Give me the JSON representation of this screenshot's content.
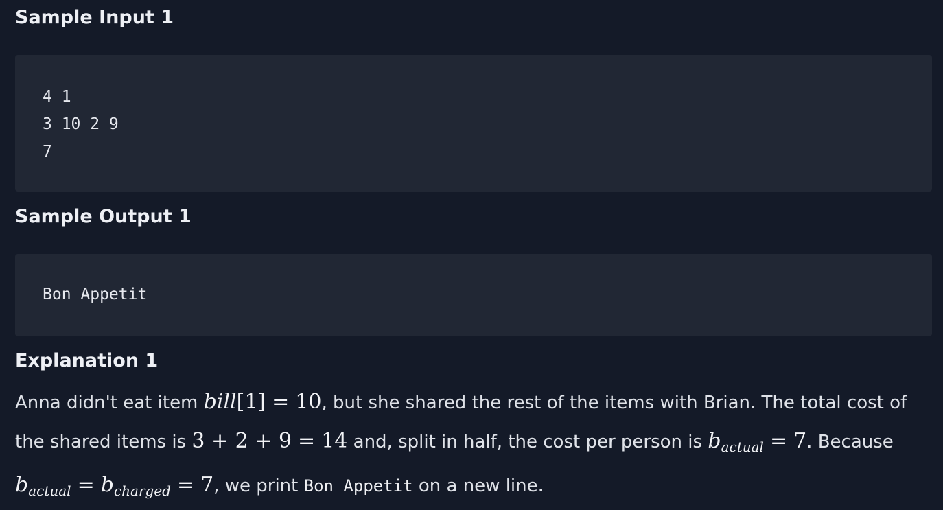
{
  "sample_input": {
    "title": "Sample Input 1",
    "lines": [
      "4 1",
      "3 10 2 9",
      "7"
    ]
  },
  "sample_output": {
    "title": "Sample Output 1",
    "value": "Bon Appetit"
  },
  "explanation": {
    "title": "Explanation 1",
    "text_1": "Anna didn't eat item ",
    "math_bill": "bill",
    "math_bill_index": "[1]",
    "math_eq": "=",
    "math_ten": "10",
    "text_2": ", but she shared the rest of the items with Brian. The total cost of the shared items is ",
    "math_sum": "3 + 2 + 9",
    "math_eq_2": "=",
    "math_fourteen": "14",
    "text_3": " and, split in half, the cost per person is ",
    "math_b": "b",
    "sub_actual": "actual",
    "math_eq_3": "=",
    "math_seven": "7",
    "text_4": ". Because ",
    "math_b_2": "b",
    "sub_actual_2": "actual",
    "math_eq_4": "=",
    "math_b_3": "b",
    "sub_charged": "charged",
    "math_eq_5": "=",
    "math_seven_2": "7",
    "text_5": ", we print ",
    "code": "Bon Appetit",
    "text_6": " on a new line."
  },
  "colors": {
    "background": "#141a28",
    "code_background": "#212734",
    "text": "#e6e8ee"
  }
}
